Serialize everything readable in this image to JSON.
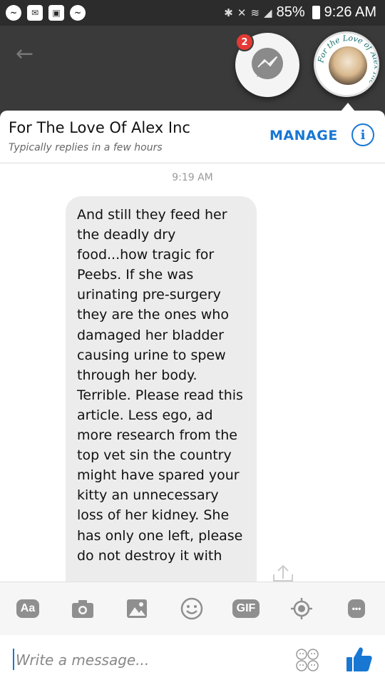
{
  "status_bar": {
    "battery": "85%",
    "time": "9:26 AM"
  },
  "chat_heads": {
    "unread_badge": "2",
    "alex_logo_text": "For the Love of Alex Inc"
  },
  "conversation": {
    "title": "For The Love Of Alex Inc",
    "subtitle": "Typically replies in a few hours",
    "manage_label": "MANAGE",
    "info_glyph": "i"
  },
  "messages": {
    "timestamp": "9:19 AM",
    "bubble_text": "And still they feed her the deadly dry food...how tragic for Peebs. If she was urinating pre-surgery they are the ones who damaged her bladder causing urine to spew through her body. Terrible. Please read this article. Less ego, ad more research from the top vet sin the country might have spared your kitty an unnecessary loss of her kidney. She has only one left, please do not destroy it with"
  },
  "composer": {
    "aa_label": "Aa",
    "gif_label": "GIF",
    "more_label": "•••",
    "placeholder": "Write a message..."
  },
  "colors": {
    "accent": "#1877d2",
    "badge": "#e53935",
    "bubble": "#ececec"
  },
  "icons": [
    "messenger-icon",
    "mail-icon",
    "gallery-icon",
    "bluetooth-icon",
    "mute-icon",
    "wifi-icon",
    "signal-icon",
    "battery-icon",
    "back-arrow-icon",
    "info-icon",
    "camera-icon",
    "image-icon",
    "smiley-icon",
    "location-icon",
    "emoji-icon",
    "thumbs-up-icon",
    "share-icon"
  ]
}
